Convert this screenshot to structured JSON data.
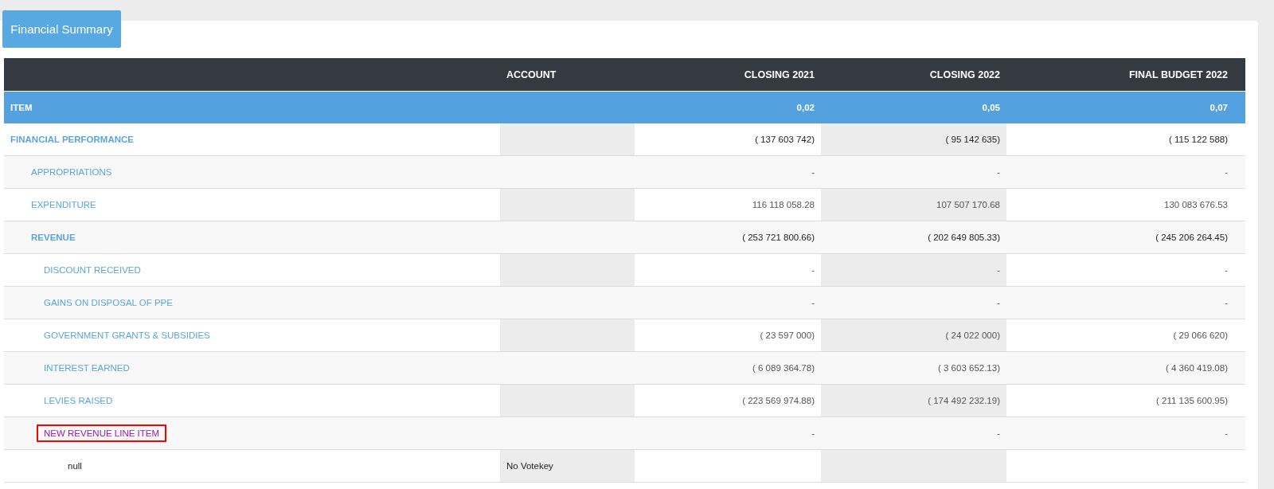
{
  "title_button": "Financial Summary",
  "table": {
    "columns": [
      "",
      "ACCOUNT",
      "CLOSING 2021",
      "CLOSING 2022",
      "FINAL BUDGET 2022"
    ],
    "total_row": {
      "label": "ITEM",
      "values": [
        "0,02",
        "0,05",
        "0,07"
      ]
    },
    "rows": [
      {
        "kind": "group",
        "label": "FINANCIAL PERFORMANCE",
        "values": [
          "( 137 603 742)",
          "( 95 142 635)",
          "( 115 122 588)"
        ],
        "children": [
          {
            "kind": "line",
            "label": "APPROPRIATIONS",
            "values": [
              "-",
              "-",
              "-"
            ]
          },
          {
            "kind": "line",
            "label": "EXPENDITURE",
            "values": [
              "116 118 058.28",
              "107 507 170.68",
              "130 083 676.53"
            ]
          },
          {
            "kind": "group",
            "label": "REVENUE",
            "values": [
              "( 253 721 800.66)",
              "( 202 649 805.33)",
              "( 245 206 264.45)"
            ],
            "children": [
              {
                "kind": "line",
                "label": "DISCOUNT RECEIVED",
                "values": [
                  "-",
                  "-",
                  "-"
                ]
              },
              {
                "kind": "line",
                "label": "GAINS ON DISPOSAL OF PPE",
                "values": [
                  "-",
                  "-",
                  "-"
                ]
              },
              {
                "kind": "line",
                "label": "GOVERNMENT GRANTS & SUBSIDIES",
                "values": [
                  "( 23 597 000)",
                  "( 24 022 000)",
                  "( 29 066 620)"
                ]
              },
              {
                "kind": "line",
                "label": "INTEREST EARNED",
                "values": [
                  "( 6 089 364.78)",
                  "( 3 603 652.13)",
                  "( 4 360 419.08)"
                ]
              },
              {
                "kind": "line",
                "label": "LEVIES RAISED",
                "values": [
                  "( 223 569 974.88)",
                  "( 174 492 232.19)",
                  "( 211 135 600.95)"
                ]
              },
              {
                "kind": "line",
                "label": "NEW REVENUE LINE ITEM",
                "highlighted": true,
                "values": [
                  "-",
                  "-",
                  "-"
                ],
                "children": [
                  {
                    "kind": "account",
                    "label": "null",
                    "account": "No Votekey"
                  }
                ]
              }
            ]
          }
        ]
      }
    ]
  }
}
